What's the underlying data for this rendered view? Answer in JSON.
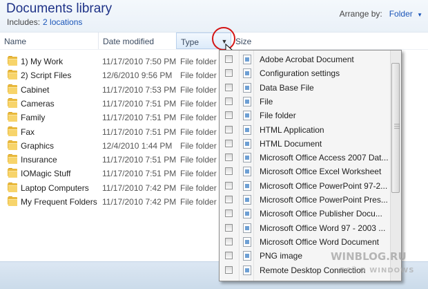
{
  "header": {
    "title": "Documents library",
    "includes_label": "Includes:",
    "includes_link": "2 locations",
    "arrange_label": "Arrange by:",
    "arrange_value": "Folder"
  },
  "columns": {
    "name": "Name",
    "date": "Date modified",
    "type": "Type",
    "size": "Size"
  },
  "files": [
    {
      "name": "1) My Work",
      "date": "11/17/2010 7:50 PM",
      "type": "File folder"
    },
    {
      "name": "2) Script Files",
      "date": "12/6/2010 9:56 PM",
      "type": "File folder"
    },
    {
      "name": "Cabinet",
      "date": "11/17/2010 7:53 PM",
      "type": "File folder"
    },
    {
      "name": "Cameras",
      "date": "11/17/2010 7:51 PM",
      "type": "File folder"
    },
    {
      "name": "Family",
      "date": "11/17/2010 7:51 PM",
      "type": "File folder"
    },
    {
      "name": "Fax",
      "date": "11/17/2010 7:51 PM",
      "type": "File folder"
    },
    {
      "name": "Graphics",
      "date": "12/4/2010 1:44 PM",
      "type": "File folder"
    },
    {
      "name": "Insurance",
      "date": "11/17/2010 7:51 PM",
      "type": "File folder"
    },
    {
      "name": "IOMagic Stuff",
      "date": "11/17/2010 7:51 PM",
      "type": "File folder"
    },
    {
      "name": "Laptop Computers",
      "date": "11/17/2010 7:42 PM",
      "type": "File folder"
    },
    {
      "name": "My Frequent Folders",
      "date": "11/17/2010 7:42 PM",
      "type": "File folder"
    }
  ],
  "type_filter": [
    "Adobe Acrobat Document",
    "Configuration settings",
    "Data Base File",
    "File",
    "File folder",
    "HTML Application",
    "HTML Document",
    "Microsoft Office Access 2007 Dat...",
    "Microsoft Office Excel Worksheet",
    "Microsoft Office PowerPoint 97-2...",
    "Microsoft Office PowerPoint Pres...",
    "Microsoft Office Publisher Docu...",
    "Microsoft Office Word 97 - 2003 ...",
    "Microsoft Office Word Document",
    "PNG image",
    "Remote Desktop Connection"
  ],
  "watermark": {
    "line1": "WINBLOG.RU",
    "line2": "ВСЁ О WINDOWS"
  },
  "colors": {
    "title": "#1e3287",
    "link": "#1a55b8",
    "highlight_circle": "#d41414"
  },
  "icons": {
    "folder": "folder-icon",
    "filter_dropdown": "chevron-down-icon",
    "checkbox": "checkbox-icon",
    "file_type": "file-type-icon",
    "pointer": "mouse-pointer-icon"
  }
}
